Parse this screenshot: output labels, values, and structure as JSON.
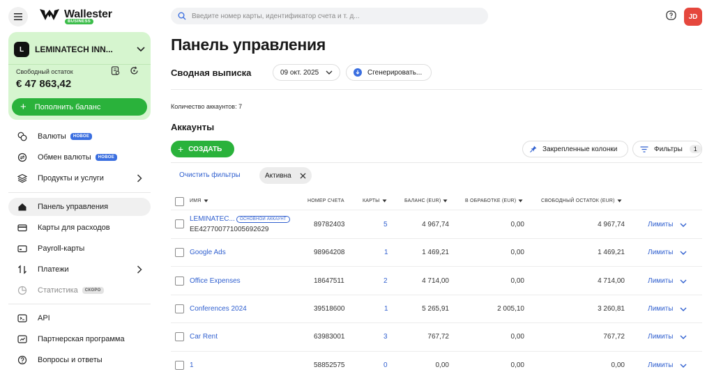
{
  "app": {
    "logo_text": "Wallester",
    "logo_badge": "BUSINESS"
  },
  "company": {
    "avatar_letter": "L",
    "name": "LEMINATECH INN...",
    "balance_label": "Свободный остаток",
    "balance_value": "€ 47 863,42",
    "topup_label": "Пополнить баланс"
  },
  "nav": {
    "currencies": {
      "label": "Валюты",
      "badge": "НОВОЕ"
    },
    "exchange": {
      "label": "Обмен валюты",
      "badge": "НОВОЕ"
    },
    "products": {
      "label": "Продукты и услуги"
    },
    "dashboard": {
      "label": "Панель управления"
    },
    "expense_cards": {
      "label": "Карты для расходов"
    },
    "payroll": {
      "label": "Payroll-карты"
    },
    "payments": {
      "label": "Платежи"
    },
    "stats": {
      "label": "Статистика",
      "badge": "СКОРО"
    },
    "api": {
      "label": "API"
    },
    "partner": {
      "label": "Партнерская программа"
    },
    "faq": {
      "label": "Вопросы и ответы"
    }
  },
  "search": {
    "placeholder": "Введите номер карты, идентификатор счета и т. д..."
  },
  "user": {
    "initials": "JD"
  },
  "main": {
    "page_title": "Панель управления",
    "summary_title": "Сводная выписка",
    "date_value": "09 окт. 2025",
    "generate_label": "Сгенерировать...",
    "accounts_count": "Количество аккаунтов: 7",
    "accounts_title": "Аккаунты",
    "create_label": "СОЗДАТЬ",
    "pinned_label": "Закрепленные колонки",
    "filters_label": "Фильтры",
    "filters_count": "1",
    "clear_filters": "Очистить фильтры",
    "active_chip": "Активна"
  },
  "table": {
    "headers": {
      "name": "ИМЯ",
      "account_number": "НОМЕР СЧЕТА",
      "cards": "КАРТЫ",
      "balance": "БАЛАНС (EUR)",
      "processing": "В ОБРАБОТКЕ (EUR)",
      "available": "СВОБОДНЫЙ ОСТАТОК (EUR)"
    },
    "main_badge": "ОСНОВНОЙ АККАУНТ",
    "limits_label": "Лимиты",
    "rows": [
      {
        "name": "LEMINATEC...",
        "iban": "EE427700771005692629",
        "number": "89782403",
        "cards": "5",
        "balance": "4 967,74",
        "processing": "0,00",
        "available": "4 967,74"
      },
      {
        "name": "Google Ads",
        "number": "98964208",
        "cards": "1",
        "balance": "1 469,21",
        "processing": "0,00",
        "available": "1 469,21"
      },
      {
        "name": "Office Expenses",
        "number": "18647511",
        "cards": "2",
        "balance": "4 714,00",
        "processing": "0,00",
        "available": "4 714,00"
      },
      {
        "name": "Conferences 2024",
        "number": "39518600",
        "cards": "1",
        "balance": "5 265,91",
        "processing": "2 005,10",
        "available": "3 260,81"
      },
      {
        "name": "Car Rent",
        "number": "63983001",
        "cards": "3",
        "balance": "767,72",
        "processing": "0,00",
        "available": "767,72"
      },
      {
        "name": "1",
        "number": "58852575",
        "cards": "0",
        "balance": "0,00",
        "processing": "0,00",
        "available": "0,00"
      }
    ]
  }
}
